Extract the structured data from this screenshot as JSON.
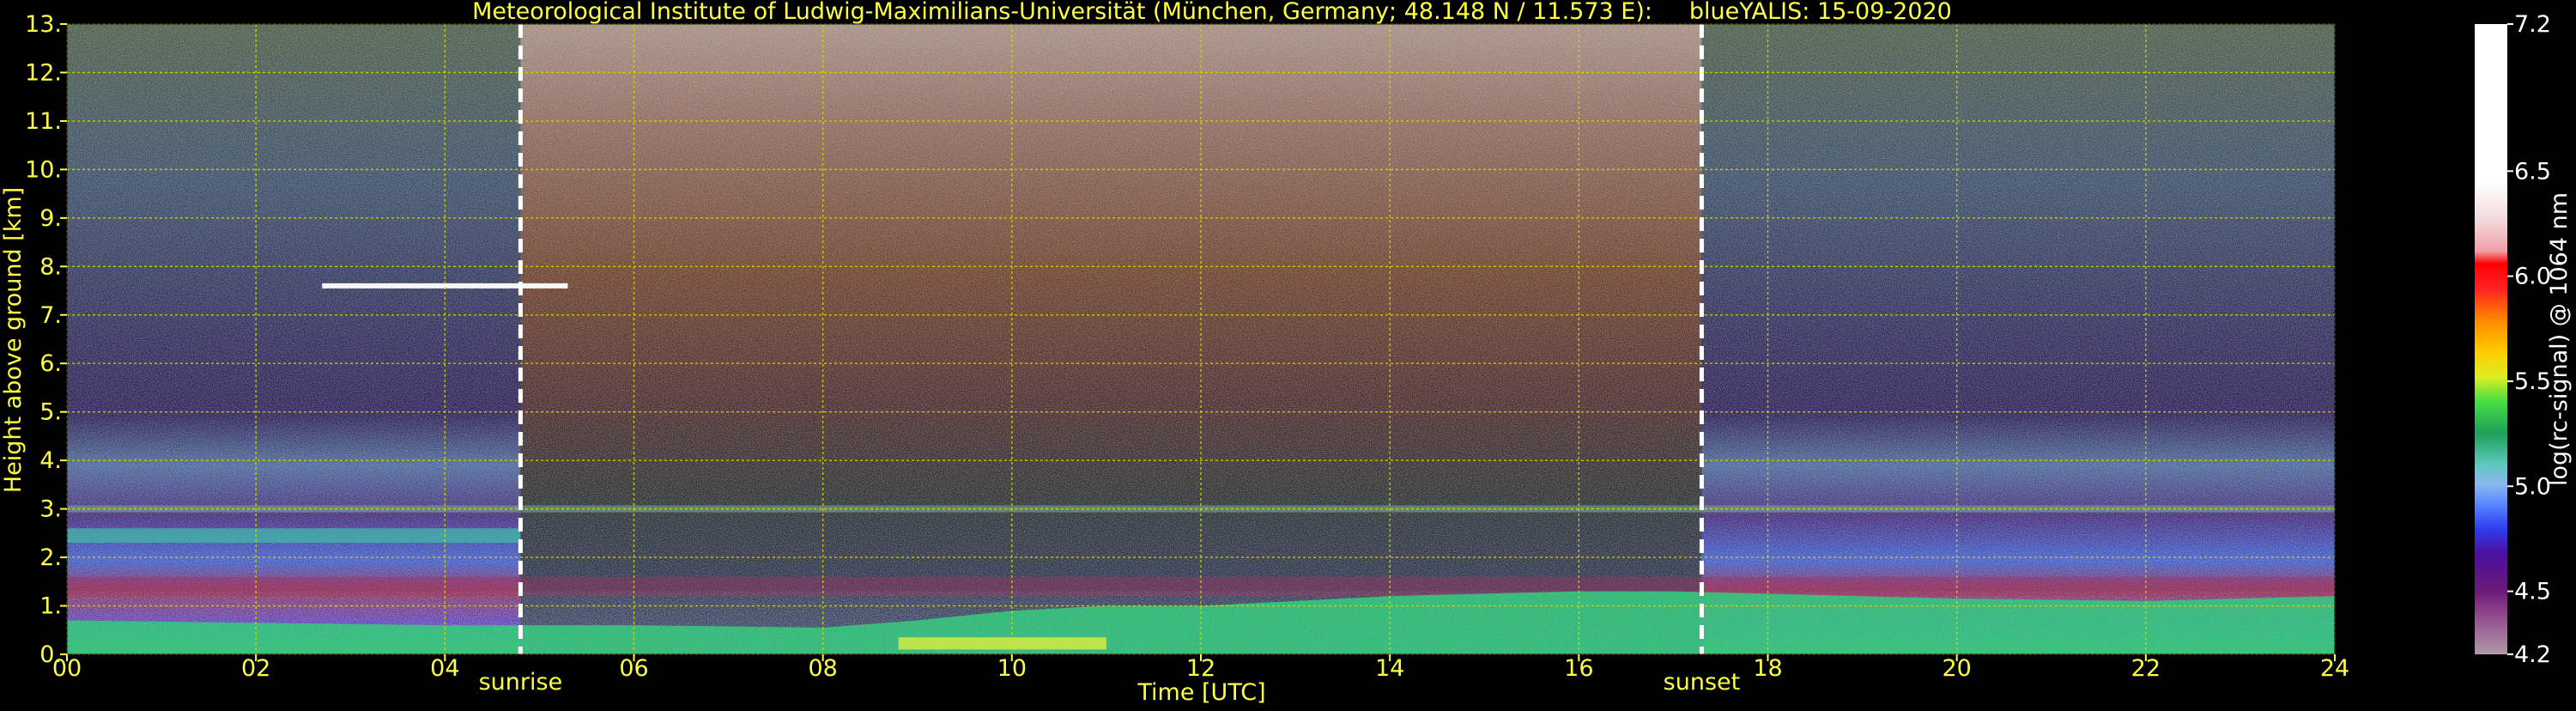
{
  "chart_data": {
    "type": "heatmap",
    "title": "Meteorological Institute of Ludwig-Maximilians-Universität (München, Germany; 48.148 N / 11.573 E):     blueYALIS: 15-09-2020",
    "xlabel": "Time [UTC]",
    "ylabel": "Height above ground [km]",
    "xlim": [
      0,
      24
    ],
    "ylim": [
      0,
      13
    ],
    "x_ticks": [
      "00",
      "02",
      "04",
      "06",
      "08",
      "10",
      "12",
      "14",
      "16",
      "18",
      "20",
      "22",
      "24"
    ],
    "y_ticks": [
      "0.",
      "1.",
      "2.",
      "3.",
      "4.",
      "5.",
      "6.",
      "7.",
      "8.",
      "9.",
      "10.",
      "11.",
      "12.",
      "13."
    ],
    "grid": true,
    "annotations": [
      {
        "text": "sunrise",
        "x": 4.8
      },
      {
        "text": "sunset",
        "x": 17.3
      }
    ],
    "colorbar": {
      "label": "log(rc-signal) @ 1064 nm",
      "range": [
        4.2,
        7.2
      ],
      "tick_labels": [
        "4.2",
        "4.5",
        "5.0",
        "5.5",
        "6.0",
        "6.5",
        "7.2"
      ],
      "tick_values": [
        4.2,
        4.5,
        5.0,
        5.5,
        6.0,
        6.5,
        7.2
      ]
    },
    "features": {
      "noisy_daytime_interval": [
        4.8,
        17.3
      ],
      "cirrus_layer": {
        "x_range": [
          2.7,
          5.3
        ],
        "height_km": 7.6
      },
      "residual_layer": {
        "height_km": 3.0
      },
      "boundary_layer_top_km": [
        [
          0,
          0.7
        ],
        [
          4,
          0.6
        ],
        [
          6,
          0.6
        ],
        [
          8,
          0.55
        ],
        [
          9,
          0.7
        ],
        [
          10,
          0.9
        ],
        [
          11,
          1.0
        ],
        [
          12,
          1.0
        ],
        [
          13,
          1.1
        ],
        [
          14,
          1.2
        ],
        [
          15,
          1.25
        ],
        [
          16,
          1.3
        ],
        [
          17,
          1.3
        ],
        [
          18,
          1.25
        ],
        [
          20,
          1.15
        ],
        [
          22,
          1.1
        ],
        [
          24,
          1.2
        ]
      ]
    },
    "colors": {
      "axis_text": "#ffff44",
      "grid": "#d8d800",
      "background": "#000000",
      "colorbar_text": "#ffffff"
    }
  }
}
